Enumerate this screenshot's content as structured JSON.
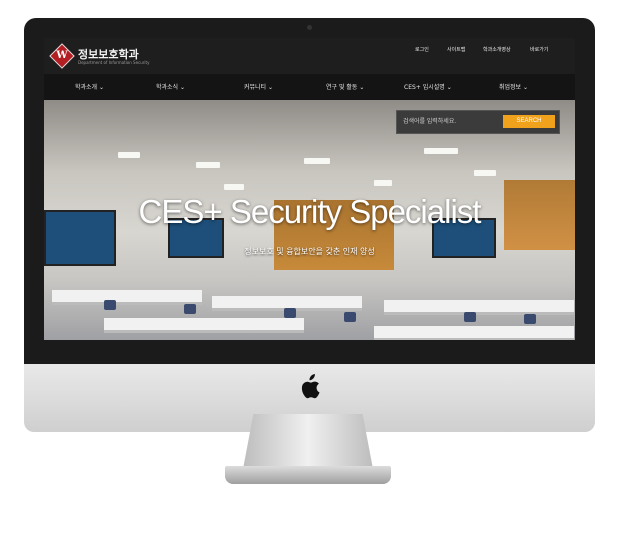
{
  "site": {
    "title": "정보보호학과",
    "subtitle": "Department of Information Security"
  },
  "util_links": [
    "로그인",
    "사이트맵",
    "학과소개영상",
    "바로가기"
  ],
  "nav": {
    "items": [
      "학과소개 ⌄",
      "학과소식 ⌄",
      "커뮤니티 ⌄",
      "연구 및 활동 ⌄",
      "CES+ 입시설명 ⌄",
      "취업정보 ⌄"
    ]
  },
  "search": {
    "placeholder": "검색어를 입력하세요.",
    "button_label": "SEARCH"
  },
  "hero": {
    "headline": "CES+  Security Specialist",
    "subline": "정보보호 및 융합보안을 갖춘 인재 양성"
  },
  "colors": {
    "accent": "#f1a21c",
    "brand": "#b41e22",
    "bar": "#1e1e1e"
  },
  "icons": {
    "logo": "diamond-logo-icon",
    "device": "apple-icon"
  }
}
